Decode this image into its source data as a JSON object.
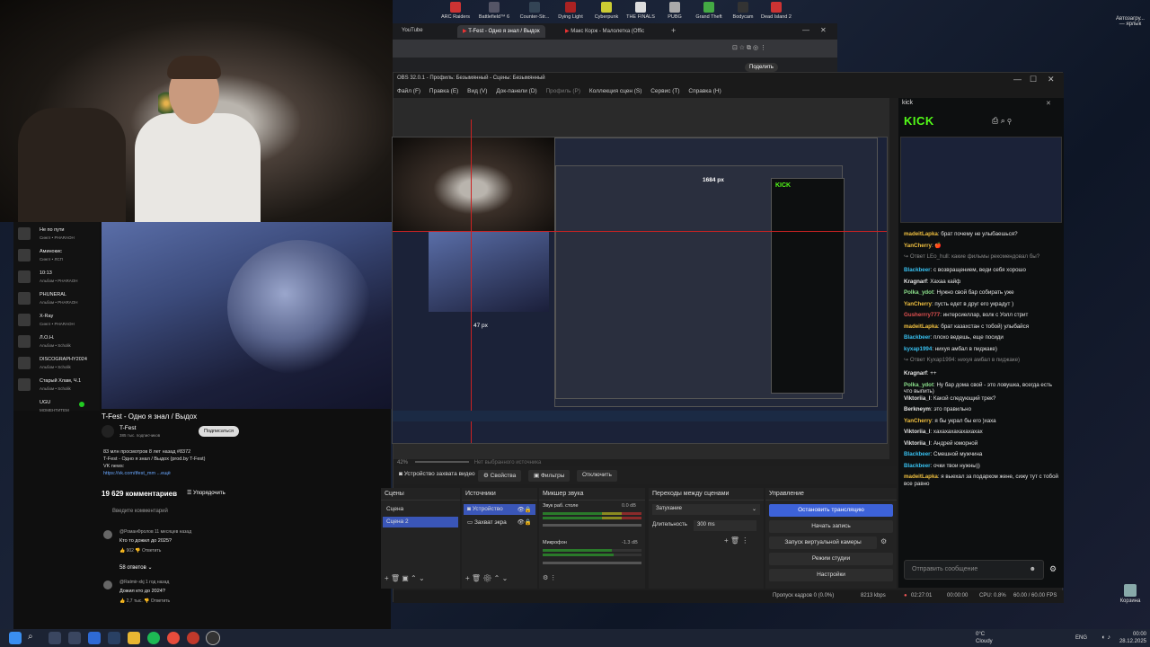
{
  "youtube": {
    "sidebar": [
      {
        "title": "Не по пути",
        "sub": "Сингл • PHARAOH"
      },
      {
        "title": "Аминокис",
        "sub": "Сингл • ЛСП"
      },
      {
        "title": "10:13",
        "sub": "Альбом • PHARAOH"
      },
      {
        "title": "PHUNERAL",
        "sub": "Альбом • PHARAOH"
      },
      {
        "title": "X-Ray",
        "sub": "Сингл • PHARAOH"
      },
      {
        "title": "Л.О.Н.",
        "sub": "Альбом • Scholik"
      },
      {
        "title": "DISCOGRAPHY2024",
        "sub": "Альбом • Scholik"
      },
      {
        "title": "Старый Хлам, Ч.1",
        "sub": "Альбом • Scholik"
      }
    ],
    "user": "UGU",
    "user_sub": "МОМЕНТИТЕМ",
    "video_title": "T-Fest - Одно я знал / Выдох",
    "channel": "T-Fest",
    "subscribers": "385 тыс. подписчиков",
    "subscribe_label": "Подписаться",
    "views": "83 млн просмотров  8 лет назад  #8372",
    "desc1": "T-Fest - Одно я знал / Выдох (prod.by T-Fest)",
    "desc2": "VK news:",
    "desc3": "https://vk.com/tfest_mm ...ещё",
    "comments_count": "19 629 комментариев",
    "sort_label": "Упорядочить",
    "comment_placeholder": "Введите комментарий",
    "c1_user": "@РоманФролов 11 месяцев назад",
    "c1_text": "Кто то дожил до 2025?",
    "c1_likes": "902",
    "c1_reply": "Ответить",
    "c1_replies": "58 ответов",
    "c2_user": "@Ratmir-xkj 1 год назад",
    "c2_text": "Дожил кто до 2024?",
    "c2_likes": "2,7 тыс."
  },
  "desktop": {
    "games": [
      "ARC Raiders",
      "Battlefield™ 6",
      "Counter-Str...",
      "Dying Light",
      "Cyberpunk",
      "THE FINALS",
      "PUBG",
      "Grand Theft",
      "Bodycam",
      "Dead Island 2"
    ],
    "corner_note": "Автозагру...\n— ярлык",
    "recycle": "Корзина"
  },
  "browser": {
    "tabs": [
      "YouTube",
      "T-Fest - Одно я знал / Выдох",
      "Макс Корж - Малолетка (Offic"
    ],
    "share_btn": "Поделить"
  },
  "obs": {
    "title": "OBS 32.0.1 - Профиль: Безымянный - Сцены: Безымянный",
    "menu": [
      "Файл (F)",
      "Правка (E)",
      "Вид (V)",
      "Док-панели (D)",
      "Профиль (P)",
      "Коллекция сцен (S)",
      "Сервис (T)",
      "Справка (H)"
    ],
    "dim_h": "1684 px",
    "dim_v": "47 px",
    "zoom": "42%",
    "no_source": "Нет выбранного источника",
    "source_name": "Устройство захвата видео",
    "props_btn": "Свойства",
    "filters_btn": "Фильтры",
    "disable_btn": "Отключить",
    "scenes_title": "Сцены",
    "scenes": [
      "Сцена",
      "Сцена 2"
    ],
    "sources_title": "Источники",
    "sources": [
      "Устройство",
      "Захват экра"
    ],
    "mixer_title": "Микшер звука",
    "mixer1": "Звук раб. столе",
    "mixer1_db": "0.0 dB",
    "mixer2": "Микрофон",
    "mixer2_db": "-1.3 dB",
    "transitions_title": "Переходы между сценами",
    "transition": "Затухание",
    "duration_label": "Длительность",
    "duration": "300 ms",
    "controls_title": "Управление",
    "ctl": [
      "Остановить трансляцию",
      "Начать запись",
      "Запуск виртуальной камеры",
      "Режим студии",
      "Настройки"
    ],
    "status_frames": "Пропуск кадров 0 (0.0%)",
    "status_kbps": "8213 kbps",
    "status_time": "02:27:01",
    "status_rec": "00:00:00",
    "status_cpu": "CPU: 0.8%",
    "status_fps": "60.00 / 60.00 FPS"
  },
  "kick": {
    "dock_title": "kick",
    "logo": "KICK",
    "input_placeholder": "Отправить сообщение",
    "chat": [
      {
        "user": "madeitLapka",
        "text": "брат почему не улыбаешься?",
        "color": "#f0c040"
      },
      {
        "user": "YanCherry",
        "text": "🍎",
        "color": "#f0c040"
      },
      {
        "user": "",
        "text": "↪ Ответ LEo_hull: какие фильмы рекомендовал бы?",
        "color": "#888"
      },
      {
        "user": "Blackbeer",
        "text": "с возвращением, веди себя хорошо",
        "color": "#38c0f0"
      },
      {
        "user": "Kragnarf",
        "text": "Хахаа кайф",
        "color": "#e5e5e5"
      },
      {
        "user": "Polka_ydot",
        "text": "Нужно свой бар собирать уже",
        "color": "#8be08b"
      },
      {
        "user": "YanCherry",
        "text": "пусть едет в друг его украдут )",
        "color": "#f0c040"
      },
      {
        "user": "Gusherrry777",
        "text": "интерсиеллар, волк с Уолл стрит",
        "color": "#e05050"
      },
      {
        "user": "madeitLapka",
        "text": "брат казахстан с тобой) улыбайся",
        "color": "#f0c040"
      },
      {
        "user": "Blackbeer",
        "text": "плохо ведешь, еще посиди",
        "color": "#38c0f0"
      },
      {
        "user": "kyxap1994",
        "text": "нихуя амбал в пиджаке)",
        "color": "#38c0f0"
      },
      {
        "user": "",
        "text": "↪ Ответ Kyxap1994: нихуя амбал в пиджаке)",
        "color": "#888"
      },
      {
        "user": "Kragnarf",
        "text": "++",
        "color": "#e5e5e5"
      },
      {
        "user": "Polka_ydot",
        "text": "Ну бар дома свой - это ловушка, всегда есть что выпить)",
        "color": "#8be08b"
      },
      {
        "user": "Viktoriia_l",
        "text": "Какой следующий трек?",
        "color": "#e5e5e5"
      },
      {
        "user": "Berkneym",
        "text": "это правильно",
        "color": "#e5e5e5"
      },
      {
        "user": "YanCherry",
        "text": "я бы украл бы его )хаха",
        "color": "#f0c040"
      },
      {
        "user": "Viktoriia_l",
        "text": "хахахахахахахахах",
        "color": "#e5e5e5"
      },
      {
        "user": "Viktoriia_l",
        "text": "Андрей юморной",
        "color": "#e5e5e5"
      },
      {
        "user": "Blackbeer",
        "text": "Смешной мужчина",
        "color": "#38c0f0"
      },
      {
        "user": "Blackbeer",
        "text": "очки твои нужны))",
        "color": "#38c0f0"
      },
      {
        "user": "madeitLapka",
        "text": "я выехал за подарком жене, сижу тут с тобой все равно",
        "color": "#f0c040"
      }
    ]
  },
  "taskbar": {
    "weather_temp": "0°C",
    "weather_desc": "Cloudy",
    "lang": "ENG",
    "time": "00:00",
    "date": "28.12.2025"
  }
}
